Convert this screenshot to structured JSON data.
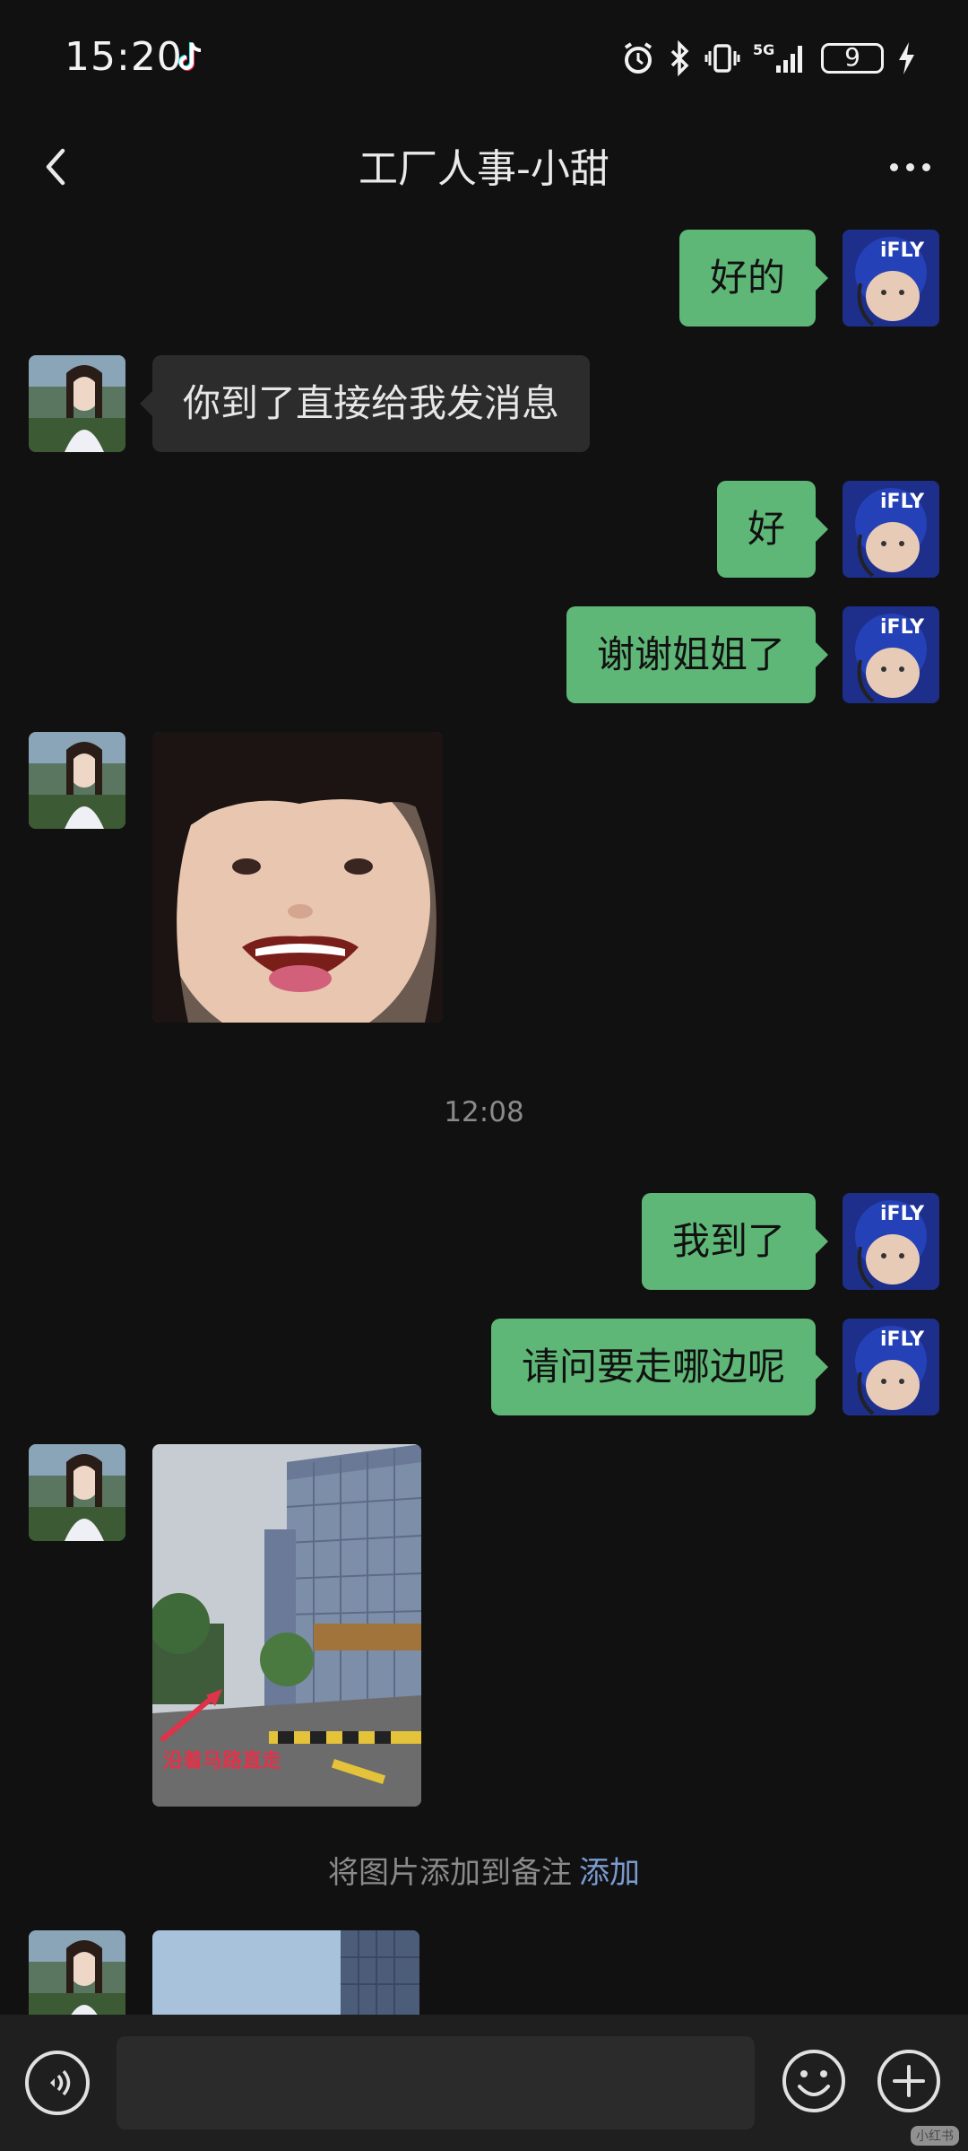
{
  "status": {
    "time": "15:20",
    "network": "5G",
    "battery": "9"
  },
  "header": {
    "title": "工厂人事-小甜"
  },
  "messages": [
    {
      "side": "out",
      "text": "好的"
    },
    {
      "side": "in",
      "text": "你到了直接给我发消息"
    },
    {
      "side": "out",
      "text": "好"
    },
    {
      "side": "out",
      "text": "谢谢姐姐了"
    },
    {
      "side": "in",
      "image": "smiling-child-sticker"
    },
    {
      "side": "out",
      "text": "我到了"
    },
    {
      "side": "out",
      "text": "请问要走哪边呢"
    },
    {
      "side": "in",
      "image": "street-photo",
      "caption": "沿着马路直走"
    },
    {
      "side": "in",
      "image": "partial-photo"
    }
  ],
  "timestamp": "12:08",
  "note": {
    "text": "将图片添加到备注",
    "action": "添加"
  },
  "watermark": "小红书",
  "icons": {
    "back": "chevron-left-icon",
    "more": "more-dots-icon",
    "voice": "voice-icon",
    "emoji": "emoji-icon",
    "plus": "plus-icon"
  },
  "colors": {
    "background": "#111111",
    "outgoing_bubble": "#5fb777",
    "incoming_bubble": "#2c2c2c",
    "link": "#7b9bd1"
  }
}
